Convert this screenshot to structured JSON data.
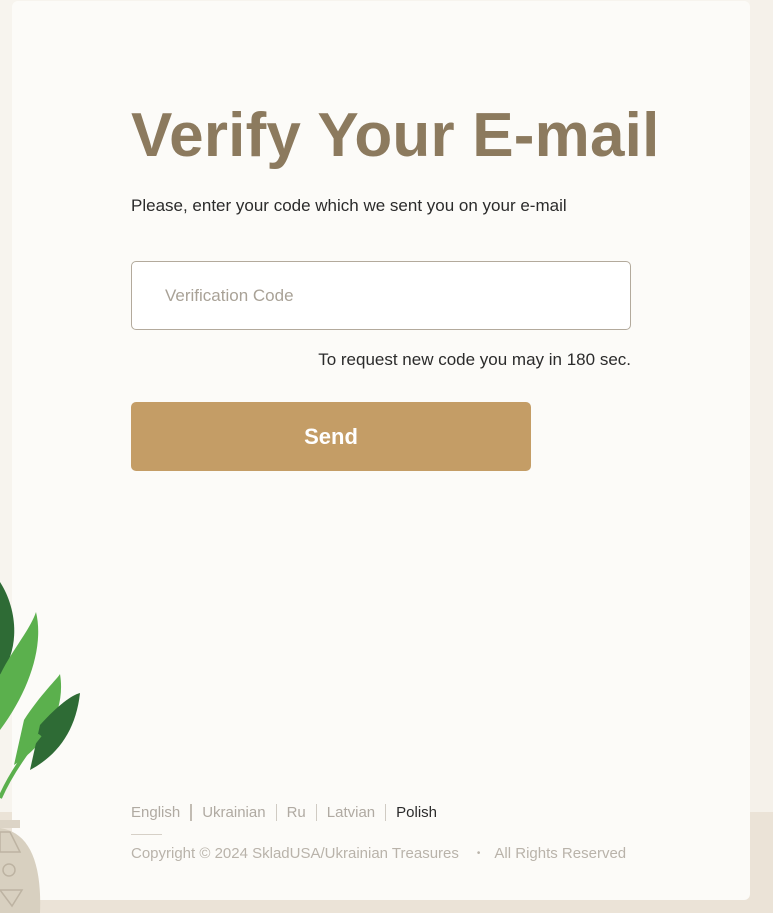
{
  "page": {
    "title": "Verify Your E-mail",
    "subtitle": "Please, enter your code which we sent you on your e-mail"
  },
  "form": {
    "code_placeholder": "Verification Code",
    "code_value": "",
    "resend_note": "To request new code you may in 180 sec.",
    "send_label": "Send"
  },
  "footer": {
    "languages": [
      {
        "label": "English",
        "active": false
      },
      {
        "label": "Ukrainian",
        "active": false
      },
      {
        "label": "Ru",
        "active": false
      },
      {
        "label": "Latvian",
        "active": false
      },
      {
        "label": "Polish",
        "active": true
      }
    ],
    "copyright": "Copyright © 2024 SkladUSA/Ukrainian Treasures",
    "separator": "•",
    "rights": "All Rights Reserved"
  },
  "colors": {
    "title": "#8c7a5e",
    "button": "#c49d66",
    "card": "#fcfbf8",
    "leaf_dark": "#2e6b35",
    "leaf_light": "#5bb04d"
  },
  "icons": {
    "decoration": "plant-vase-illustration"
  }
}
